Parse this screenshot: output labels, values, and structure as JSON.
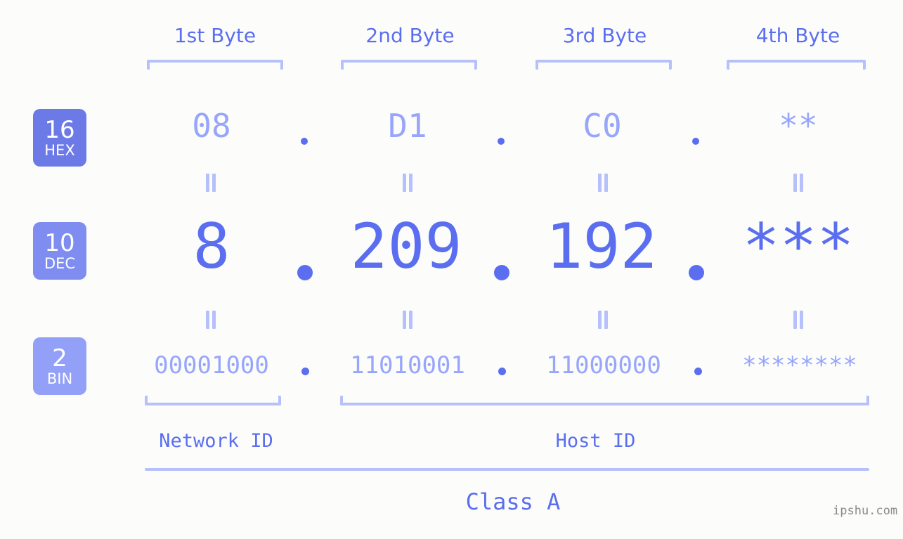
{
  "background_color": "#fcfdfa",
  "accent_color": "#5b6ef0",
  "accent_light_color": "#97a6fb",
  "bracket_color": "#b6c1fb",
  "byte_headers": [
    {
      "label": "1st Byte"
    },
    {
      "label": "2nd Byte"
    },
    {
      "label": "3rd Byte"
    },
    {
      "label": "4th Byte"
    }
  ],
  "bases": [
    {
      "number": "16",
      "name": "HEX",
      "color": "#6c7ae8"
    },
    {
      "number": "10",
      "name": "DEC",
      "color": "#7f8df0"
    },
    {
      "number": "2",
      "name": "BIN",
      "color": "#92a0f8"
    }
  ],
  "rows": {
    "hex": {
      "values": [
        "08",
        "D1",
        "C0",
        "**"
      ]
    },
    "dec": {
      "values": [
        "8",
        "209",
        "192",
        "***"
      ]
    },
    "bin": {
      "values": [
        "00001000",
        "11010001",
        "11000000",
        "********"
      ]
    }
  },
  "separator": ".",
  "equals_mark": "=",
  "segments": {
    "network_id": "Network ID",
    "host_id": "Host ID"
  },
  "class_label": "Class A",
  "watermark": "ipshu.com"
}
